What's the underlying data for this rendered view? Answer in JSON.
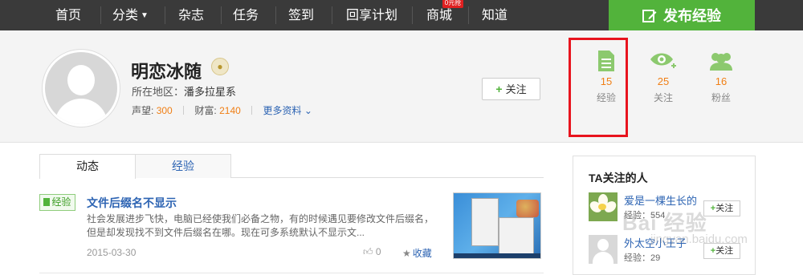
{
  "nav": {
    "items": [
      "首页",
      "分类",
      "杂志",
      "任务",
      "签到",
      "回享计划",
      "商城",
      "知道"
    ],
    "mall_badge": "0元抢",
    "publish": "发布经验"
  },
  "profile": {
    "name": "明恋冰随",
    "location_label": "所在地区：",
    "location": "潘多拉星系",
    "reputation_label": "声望:",
    "reputation": "300",
    "wealth_label": "财富:",
    "wealth": "2140",
    "more": "更多资料",
    "follow": "关注"
  },
  "stats": [
    {
      "value": "15",
      "label": "经验"
    },
    {
      "value": "25",
      "label": "关注"
    },
    {
      "value": "16",
      "label": "粉丝"
    }
  ],
  "tabs": [
    "动态",
    "经验"
  ],
  "post": {
    "badge": "经验",
    "title": "文件后缀名不显示",
    "summary": "社会发展进步飞快，电脑已经使我们必备之物，有的时候遇见要修改文件后缀名，但是却发现找不到文件后缀名在哪。现在可多系统默认不显示文...",
    "date": "2015-03-30",
    "likes": "0",
    "favorite": "收藏"
  },
  "sidebar": {
    "title": "TA关注的人",
    "users": [
      {
        "name": "爱是一棵生长的",
        "exp": "经验：554",
        "follow": "关注"
      },
      {
        "name": "外太空小王子",
        "exp": "经验：29",
        "follow": "关注"
      }
    ]
  },
  "watermark": {
    "text": "Bai 经验",
    "url": "jingyan.baidu.com"
  },
  "colors": {
    "nav_bg": "#3a3a3a",
    "publish_green": "#52b33b",
    "accent_orange": "#f07f15",
    "link_blue": "#2d64b3",
    "highlight_red": "#e8141e"
  }
}
